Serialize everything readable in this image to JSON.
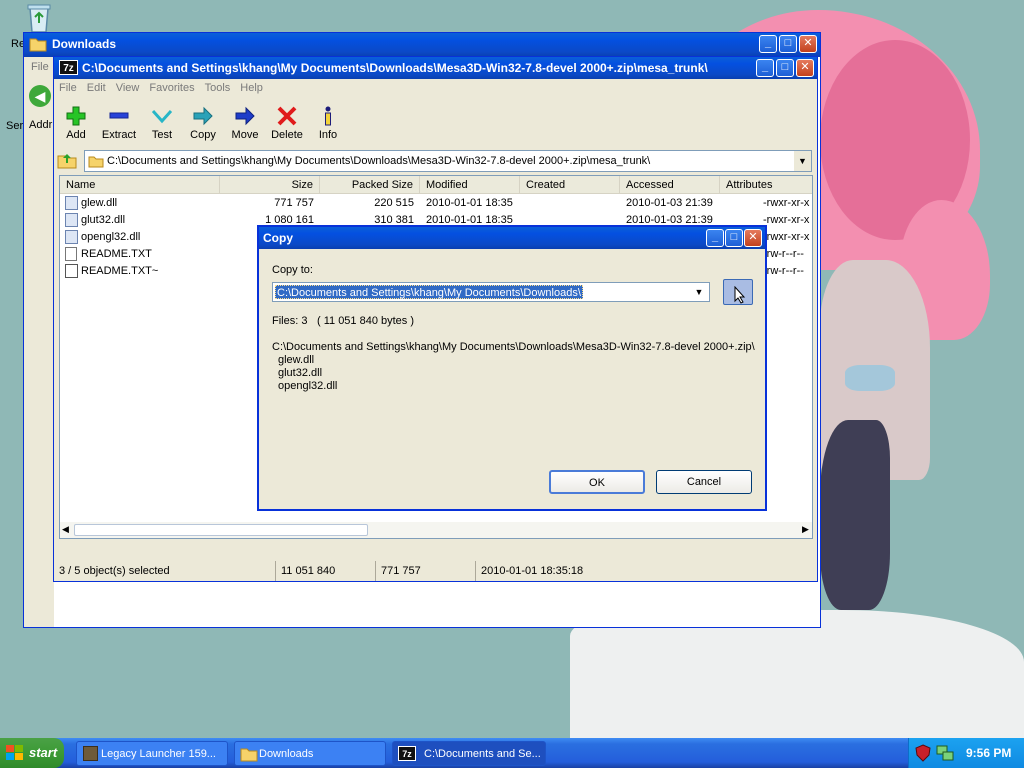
{
  "desktop": {
    "icons": [
      "recycle-bin-icon"
    ],
    "partial_labels": [
      "Re",
      "Ser",
      "Addr"
    ]
  },
  "downloads_window": {
    "title": "Downloads",
    "menu": [
      "File"
    ]
  },
  "sevenzip_window": {
    "title": "C:\\Documents and Settings\\khang\\My Documents\\Downloads\\Mesa3D-Win32-7.8-devel 2000+.zip\\mesa_trunk\\",
    "menu": [
      "File",
      "Edit",
      "View",
      "Favorites",
      "Tools",
      "Help"
    ],
    "toolbar": [
      {
        "label": "Add",
        "icon": "add-icon"
      },
      {
        "label": "Extract",
        "icon": "extract-icon"
      },
      {
        "label": "Test",
        "icon": "test-icon"
      },
      {
        "label": "Copy",
        "icon": "copy-icon"
      },
      {
        "label": "Move",
        "icon": "move-icon"
      },
      {
        "label": "Delete",
        "icon": "delete-icon"
      },
      {
        "label": "Info",
        "icon": "info-icon"
      }
    ],
    "address": "C:\\Documents and Settings\\khang\\My Documents\\Downloads\\Mesa3D-Win32-7.8-devel 2000+.zip\\mesa_trunk\\",
    "columns": [
      "Name",
      "Size",
      "Packed Size",
      "Modified",
      "Created",
      "Accessed",
      "Attributes"
    ],
    "files": [
      {
        "name": "glew.dll",
        "size": "771 757",
        "packed": "220 515",
        "modified": "2010-01-01 18:35",
        "accessed": "2010-01-03 21:39",
        "attributes": "-rwxr-xr-x"
      },
      {
        "name": "glut32.dll",
        "size": "1 080 161",
        "packed": "310 381",
        "modified": "2010-01-01 18:35",
        "accessed": "2010-01-03 21:39",
        "attributes": "-rwxr-xr-x"
      },
      {
        "name": "opengl32.dll",
        "size": "",
        "packed": "",
        "modified": "",
        "accessed": "",
        "attributes": "-rwxr-xr-x"
      },
      {
        "name": "README.TXT",
        "size": "",
        "packed": "",
        "modified": "",
        "accessed": "",
        "attributes": "-rw-r--r--"
      },
      {
        "name": "README.TXT~",
        "size": "",
        "packed": "",
        "modified": "",
        "accessed": "",
        "attributes": "-rw-r--r--"
      }
    ],
    "status": {
      "selected": "3 / 5 object(s) selected",
      "size": "11 051 840",
      "packed": "771 757",
      "modified": "2010-01-01 18:35:18"
    }
  },
  "copy_dialog": {
    "title": "Copy",
    "copy_to_label": "Copy to:",
    "copy_to_value": "C:\\Documents and Settings\\khang\\My Documents\\Downloads\\",
    "files_label": "Files: 3",
    "bytes": "( 11 051 840 bytes )",
    "source_path": "C:\\Documents and Settings\\khang\\My Documents\\Downloads\\Mesa3D-Win32-7.8-devel 2000+.zip\\",
    "file_list": [
      "glew.dll",
      "glut32.dll",
      "opengl32.dll"
    ],
    "ok_label": "OK",
    "cancel_label": "Cancel",
    "browse_label": "..."
  },
  "taskbar": {
    "start_label": "start",
    "buttons": [
      {
        "label": "Legacy Launcher 159...",
        "icon": "minecraft-block-icon"
      },
      {
        "label": "Downloads",
        "icon": "folder-icon"
      },
      {
        "label": "C:\\Documents and Se...",
        "icon": "7zip-icon",
        "active": true
      }
    ],
    "clock": "9:56 PM"
  }
}
